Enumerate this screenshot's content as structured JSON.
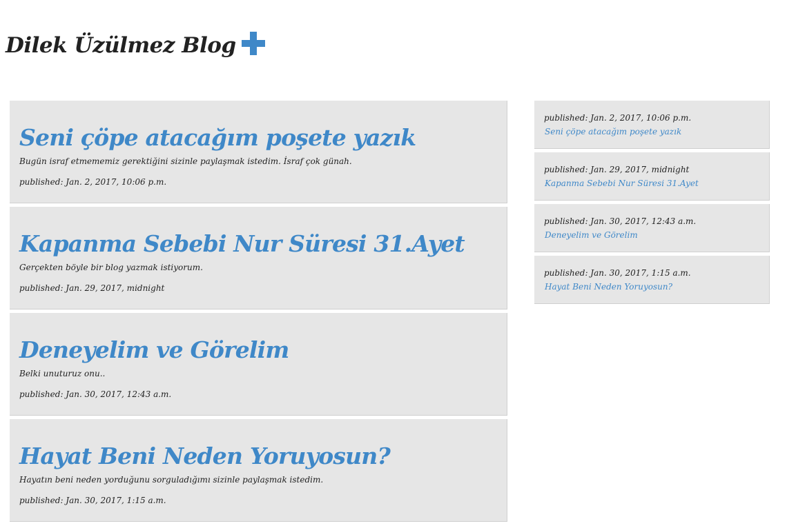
{
  "site": {
    "title": "Dilek Üzülmez Blog"
  },
  "posts": [
    {
      "title": "Seni çöpe atacağım poşete yazık",
      "excerpt": "Bugün israf etmememiz gerektiğini sizinle paylaşmak istedim. İsraf çok günah.",
      "published": "published: Jan. 2, 2017, 10:06 p.m."
    },
    {
      "title": "Kapanma Sebebi Nur Süresi 31.Ayet",
      "excerpt": "Gerçekten böyle bir blog yazmak istiyorum.",
      "published": "published: Jan. 29, 2017, midnight"
    },
    {
      "title": "Deneyelim ve Görelim",
      "excerpt": "Belki unuturuz onu..",
      "published": "published: Jan. 30, 2017, 12:43 a.m."
    },
    {
      "title": "Hayat Beni Neden Yoruyosun?",
      "excerpt": "Hayatın beni neden yorduğunu sorguladığımı sizinle paylaşmak istedim.",
      "published": "published: Jan. 30, 2017, 1:15 a.m."
    }
  ],
  "sidebar": [
    {
      "published": "published: Jan. 2, 2017, 10:06 p.m.",
      "title": "Seni çöpe atacağım poşete yazık"
    },
    {
      "published": "published: Jan. 29, 2017, midnight",
      "title": "Kapanma Sebebi Nur Süresi 31.Ayet"
    },
    {
      "published": "published: Jan. 30, 2017, 12:43 a.m.",
      "title": "Deneyelim ve Görelim"
    },
    {
      "published": "published: Jan. 30, 2017, 1:15 a.m.",
      "title": "Hayat Beni Neden Yoruyosun?"
    }
  ],
  "icons": {
    "add": "plus-icon"
  },
  "colors": {
    "accent": "#3f88c8",
    "card_background": "#e6e6e6",
    "text": "#222222"
  }
}
